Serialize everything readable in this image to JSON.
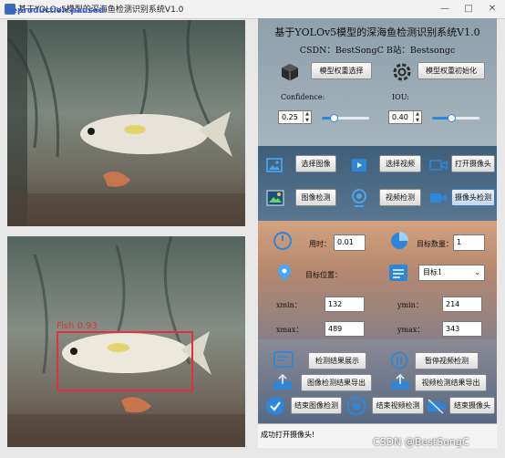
{
  "window": {
    "title": "基于YOLOv5模型的深海鱼检测识别系统V1.0",
    "watermark": "Reproduction paused",
    "controls": [
      "—",
      "□",
      "✕"
    ]
  },
  "video_top": {
    "name": "original-frame"
  },
  "video_bottom": {
    "detection_label": "Fish  0.93"
  },
  "header": {
    "system_title": "基于YOLOv5模型的深海鱼检测识别系统V1.0",
    "credits": "CSDN：BestSongC    B站：Bestsongc"
  },
  "model": {
    "select_label": "模型权重选择",
    "init_label": "模型权重初始化",
    "confidence_label": "Confidence:",
    "iou_label": "IOU:",
    "confidence_value": "0.25",
    "iou_value": "0.40",
    "confidence_level": 0.25,
    "iou_level": 0.4
  },
  "inputs": {
    "select_image": "选择图像",
    "select_video": "选择视频",
    "open_camera": "打开摄像头",
    "image_detect": "图像检测",
    "video_detect": "视频检测",
    "camera_detect": "摄像头检测"
  },
  "results": {
    "time_label": "用时：",
    "time_value": "0.01",
    "count_label": "目标数量：",
    "count_value": "1",
    "position_label": "目标位置：",
    "target_select": "目标1",
    "xmin_label": "xmin：",
    "xmin_value": "132",
    "ymin_label": "ymin：",
    "ymin_value": "214",
    "xmax_label": "xmax：",
    "xmax_value": "489",
    "ymax_label": "ymax：",
    "ymax_value": "343"
  },
  "actions": {
    "show_results": "检测结果展示",
    "pause_video": "暂停视频检测",
    "export_image": "图像检测结果导出",
    "export_video": "视频检测结果导出",
    "end_image": "结束图像检测",
    "end_video": "结束视频检测",
    "end_camera": "结束摄像头"
  },
  "status": {
    "message": "成功打开摄像头!"
  },
  "overlay": {
    "csdn_mark": "CSDN @BestSongC"
  },
  "colors": {
    "accent": "#2f86d8",
    "detection": "#e2303f"
  }
}
